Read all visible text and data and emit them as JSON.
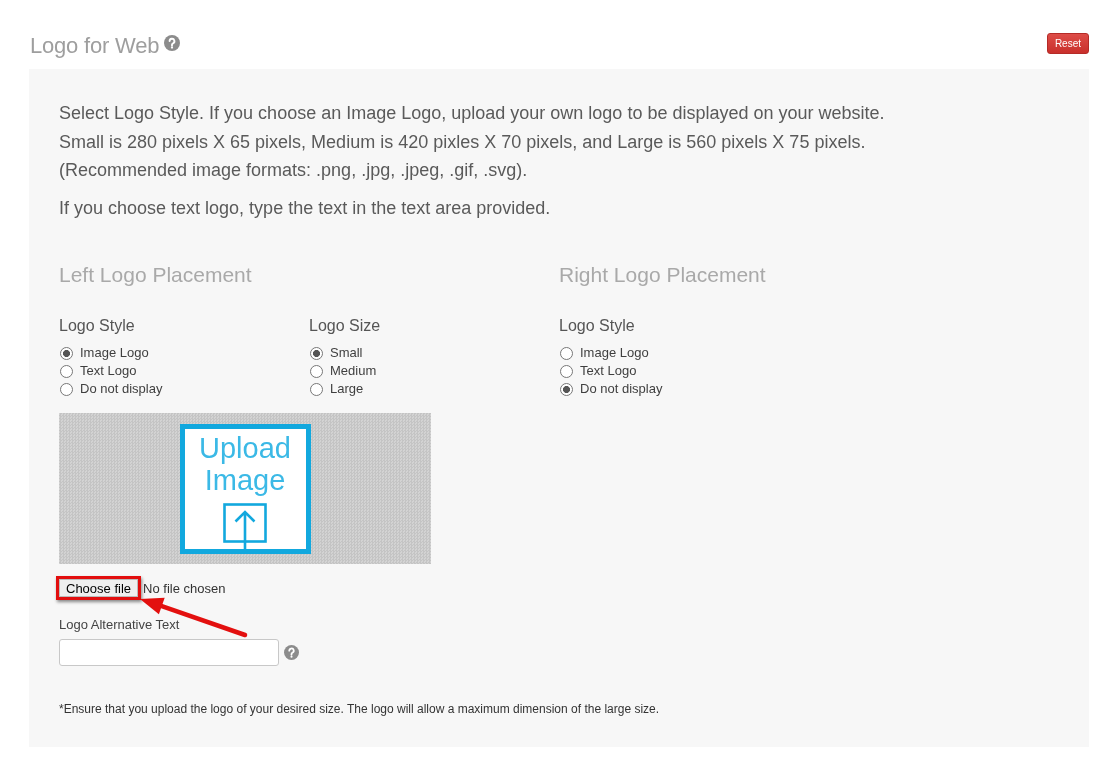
{
  "header": {
    "title": "Logo for Web",
    "reset_button": "Reset"
  },
  "intro": [
    "Select Logo Style. If you choose an Image Logo, upload your own logo to be displayed on your website.\nSmall is 280 pixels X 65 pixels, Medium is 420 pixles X 70 pixels, and Large is 560 pixels X 75 pixels.\n(Recommended image formats: .png, .jpg, .jpeg, .gif, .svg).",
    "If you choose text logo, type the text in the text area provided."
  ],
  "placements": [
    {
      "heading": "Left Logo Placement",
      "groups": [
        {
          "label": "Logo Style",
          "options": [
            {
              "label": "Image Logo",
              "selected": true
            },
            {
              "label": "Text Logo",
              "selected": false
            },
            {
              "label": "Do not display",
              "selected": false
            }
          ]
        },
        {
          "label": "Logo Size",
          "options": [
            {
              "label": "Small",
              "selected": true
            },
            {
              "label": "Medium",
              "selected": false
            },
            {
              "label": "Large",
              "selected": false
            }
          ]
        }
      ],
      "upload": {
        "text": "Upload Image"
      },
      "file_input": {
        "button": "Choose file",
        "status": "No file chosen",
        "highlighted": true
      },
      "alt_text": {
        "label": "Logo Alternative Text"
      }
    },
    {
      "heading": "Right Logo Placement",
      "groups": [
        {
          "label": "Logo Style",
          "options": [
            {
              "label": "Image Logo",
              "selected": false
            },
            {
              "label": "Text Logo",
              "selected": false
            },
            {
              "label": "Do not display",
              "selected": true
            }
          ]
        }
      ]
    }
  ],
  "footnote": "*Ensure that you upload the logo of your desired size. The logo will allow a maximum dimension of the large size."
}
